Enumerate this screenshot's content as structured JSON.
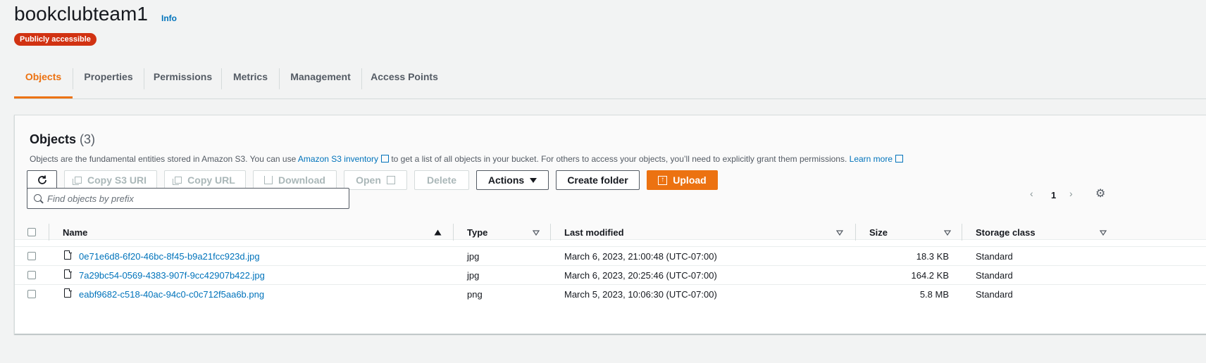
{
  "header": {
    "title": "bookclubteam1",
    "info_label": "Info",
    "badge": "Publicly accessible"
  },
  "tabs": [
    {
      "label": "Objects",
      "active": true
    },
    {
      "label": "Properties",
      "active": false
    },
    {
      "label": "Permissions",
      "active": false
    },
    {
      "label": "Metrics",
      "active": false
    },
    {
      "label": "Management",
      "active": false
    },
    {
      "label": "Access Points",
      "active": false
    }
  ],
  "objects": {
    "title": "Objects",
    "count": "(3)",
    "desc_before": "Objects are the fundamental entities stored in Amazon S3. You can use",
    "inventory_link": "Amazon S3 inventory",
    "desc_after": "to get a list of all objects in your bucket. For others to access your objects, you’ll need to explicitly grant them permissions.",
    "learn_more": "Learn more"
  },
  "toolbar": {
    "copy_uri": "Copy S3 URI",
    "copy_url": "Copy URL",
    "download": "Download",
    "open": "Open",
    "delete": "Delete",
    "actions": "Actions",
    "create_folder": "Create folder",
    "upload": "Upload"
  },
  "search": {
    "placeholder": "Find objects by prefix"
  },
  "pagination": {
    "page": "1"
  },
  "table": {
    "headers": {
      "name": "Name",
      "type": "Type",
      "last_modified": "Last modified",
      "size": "Size",
      "storage_class": "Storage class"
    },
    "rows": [
      {
        "name": "0e71e6d8-6f20-46bc-8f45-b9a21fcc923d.jpg",
        "type": "jpg",
        "modified": "March 6, 2023, 21:00:48 (UTC-07:00)",
        "size": "18.3 KB",
        "storage": "Standard"
      },
      {
        "name": "7a29bc54-0569-4383-907f-9cc42907b422.jpg",
        "type": "jpg",
        "modified": "March 6, 2023, 20:25:46 (UTC-07:00)",
        "size": "164.2 KB",
        "storage": "Standard"
      },
      {
        "name": "eabf9682-c518-40ac-94c0-c0c712f5aa6b.png",
        "type": "png",
        "modified": "March 5, 2023, 10:06:30 (UTC-07:00)",
        "size": "5.8 MB",
        "storage": "Standard"
      }
    ]
  },
  "colors": {
    "accent": "#ec7211",
    "link": "#0073bb",
    "badge": "#d13212"
  }
}
